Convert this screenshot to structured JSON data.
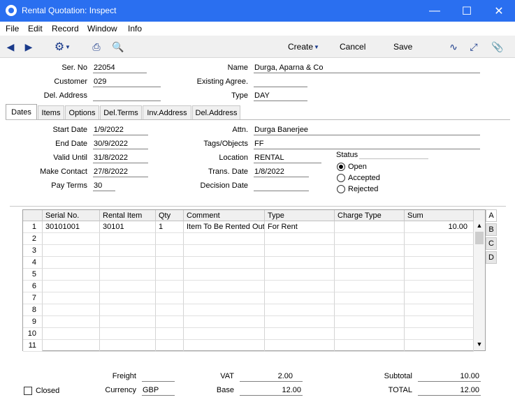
{
  "window": {
    "title": "Rental Quotation: Inspect"
  },
  "menu": [
    "File",
    "Edit",
    "Record",
    "Window",
    "Info"
  ],
  "toolbar": {
    "create": "Create",
    "cancel": "Cancel",
    "save": "Save"
  },
  "header": {
    "ser_no_label": "Ser. No",
    "ser_no": "22054",
    "customer_label": "Customer",
    "customer": "029",
    "del_address_label": "Del. Address",
    "del_address": "",
    "name_label": "Name",
    "name": "Durga, Aparna & Co",
    "existing_agree_label": "Existing Agree.",
    "existing_agree": "",
    "type_label": "Type",
    "type": "DAY"
  },
  "tabs": [
    "Dates",
    "Items",
    "Options",
    "Del.Terms",
    "Inv.Address",
    "Del.Address"
  ],
  "dates": {
    "start_date_label": "Start Date",
    "start_date": "1/9/2022",
    "end_date_label": "End Date",
    "end_date": "30/9/2022",
    "valid_until_label": "Valid Until",
    "valid_until": "31/8/2022",
    "make_contact_label": "Make Contact",
    "make_contact": "27/8/2022",
    "pay_terms_label": "Pay Terms",
    "pay_terms": "30",
    "attn_label": "Attn.",
    "attn": "Durga Banerjee",
    "tags_label": "Tags/Objects",
    "tags": "FF",
    "location_label": "Location",
    "location": "RENTAL",
    "trans_date_label": "Trans. Date",
    "trans_date": "1/8/2022",
    "decision_date_label": "Decision Date",
    "decision_date": "",
    "status_label": "Status",
    "status_options": [
      "Open",
      "Accepted",
      "Rejected"
    ],
    "status_selected": "Open"
  },
  "grid": {
    "columns": [
      "Serial No.",
      "Rental Item",
      "Qty",
      "Comment",
      "Type",
      "Charge Type",
      "Sum"
    ],
    "rows": [
      [
        "30101001",
        "30101",
        "1",
        "Item To Be Rented Out",
        "For Rent",
        "",
        "10.00"
      ],
      [
        "",
        "",
        "",
        "",
        "",
        "",
        ""
      ],
      [
        "",
        "",
        "",
        "",
        "",
        "",
        ""
      ],
      [
        "",
        "",
        "",
        "",
        "",
        "",
        ""
      ],
      [
        "",
        "",
        "",
        "",
        "",
        "",
        ""
      ],
      [
        "",
        "",
        "",
        "",
        "",
        "",
        ""
      ],
      [
        "",
        "",
        "",
        "",
        "",
        "",
        ""
      ],
      [
        "",
        "",
        "",
        "",
        "",
        "",
        ""
      ],
      [
        "",
        "",
        "",
        "",
        "",
        "",
        ""
      ],
      [
        "",
        "",
        "",
        "",
        "",
        "",
        ""
      ],
      [
        "",
        "",
        "",
        "",
        "",
        "",
        ""
      ]
    ],
    "row_numbers": [
      "1",
      "2",
      "3",
      "4",
      "5",
      "6",
      "7",
      "8",
      "9",
      "10",
      "11"
    ],
    "side_tabs": [
      "A",
      "B",
      "C",
      "D"
    ]
  },
  "footer": {
    "freight_label": "Freight",
    "freight": "",
    "currency_label": "Currency",
    "currency": "GBP",
    "vat_label": "VAT",
    "vat": "2.00",
    "base_label": "Base",
    "base": "12.00",
    "subtotal_label": "Subtotal",
    "subtotal": "10.00",
    "total_label": "TOTAL",
    "total": "12.00",
    "closed_label": "Closed"
  }
}
